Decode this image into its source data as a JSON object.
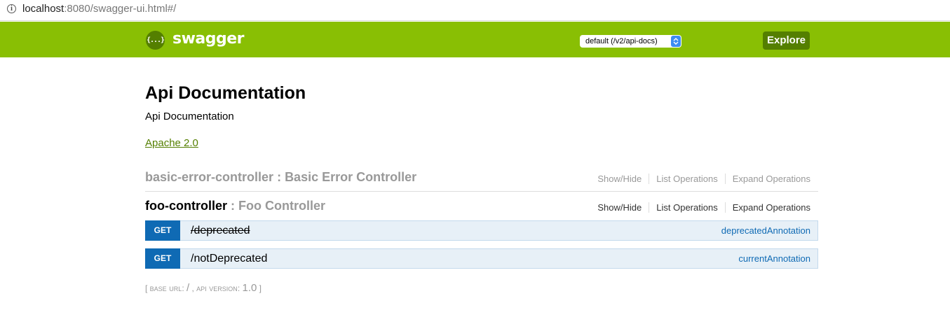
{
  "browser": {
    "url_host": "localhost",
    "url_rest": ":8080/swagger-ui.html#/"
  },
  "header": {
    "logo_text": "swagger",
    "logo_glyph": "{...}",
    "spec_select_value": "default (/v2/api-docs)",
    "explore_label": "Explore",
    "colors": {
      "bar": "#89bf04",
      "dark": "#547f00"
    }
  },
  "info": {
    "title": "Api Documentation",
    "description": "Api Documentation",
    "license": "Apache 2.0"
  },
  "resources": [
    {
      "name": "basic-error-controller",
      "separator": " : ",
      "description": "Basic Error Controller",
      "actions": [
        "Show/Hide",
        "List Operations",
        "Expand Operations"
      ],
      "state": "collapsed"
    },
    {
      "name": "foo-controller",
      "separator": " : ",
      "description": "Foo Controller",
      "actions": [
        "Show/Hide",
        "List Operations",
        "Expand Operations"
      ],
      "state": "expanded",
      "operations": [
        {
          "method": "GET",
          "path": "/deprecated",
          "summary": "deprecatedAnnotation",
          "deprecated": true
        },
        {
          "method": "GET",
          "path": "/notDeprecated",
          "summary": "currentAnnotation",
          "deprecated": false
        }
      ]
    }
  ],
  "footer": {
    "open": "[ ",
    "base_url_label": "base url",
    "colon1": ": ",
    "base_url_value": "/",
    "comma": " , ",
    "api_version_label": "api version",
    "colon2": ": ",
    "api_version_value": "1.0",
    "close": " ]"
  },
  "icons": {
    "info": "info-circle-icon",
    "select_arrows": "up-down-chevron-icon"
  }
}
